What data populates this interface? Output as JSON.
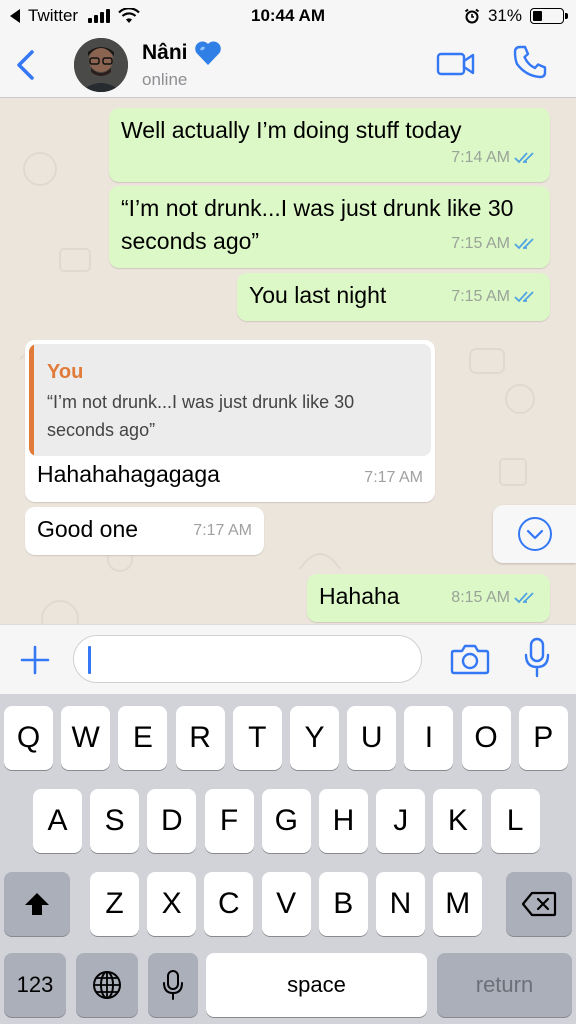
{
  "status_bar": {
    "back_app": "Twitter",
    "time": "10:44 AM",
    "battery": "31%",
    "battery_level": 0.31
  },
  "header": {
    "contact_name": "Nâni",
    "name_emoji": "💙",
    "status": "online"
  },
  "messages": [
    {
      "direction": "out",
      "text": "Well actually I’m doing stuff today",
      "time": "7:14 AM"
    },
    {
      "direction": "out",
      "text": "“I’m not drunk...I was just drunk like 30 seconds ago”",
      "time": "7:15 AM"
    },
    {
      "direction": "out",
      "text": "You last night",
      "time": "7:15 AM"
    },
    {
      "direction": "in",
      "reply_author": "You",
      "reply_text": "“I’m not drunk...I was just drunk like 30 seconds ago”",
      "text": "Hahahahagagaga",
      "time": "7:17 AM"
    },
    {
      "direction": "in",
      "text": "Good one",
      "time": "7:17 AM"
    },
    {
      "direction": "out",
      "text": "Hahaha",
      "time": "8:15 AM"
    }
  ],
  "input": {
    "value": "",
    "placeholder": ""
  },
  "keyboard": {
    "row1": [
      "Q",
      "W",
      "E",
      "R",
      "T",
      "Y",
      "U",
      "I",
      "O",
      "P"
    ],
    "row2": [
      "A",
      "S",
      "D",
      "F",
      "G",
      "H",
      "J",
      "K",
      "L"
    ],
    "row3": [
      "Z",
      "X",
      "C",
      "V",
      "B",
      "N",
      "M"
    ],
    "numbers_label": "123",
    "space_label": "space",
    "return_label": "return"
  },
  "colors": {
    "accent": "#3478f6",
    "outgoing_bubble": "#dcf8c6",
    "incoming_bubble": "#ffffff",
    "reply_accent": "#e07b39",
    "read_ticks": "#4fa3e3"
  },
  "icons": [
    "back-chevron-icon",
    "video-call-icon",
    "phone-icon",
    "plus-icon",
    "camera-icon",
    "microphone-icon",
    "scroll-down-icon",
    "read-ticks-icon",
    "shift-icon",
    "backspace-icon",
    "globe-icon",
    "keyboard-mic-icon",
    "wifi-icon",
    "alarm-icon",
    "blue-heart-icon"
  ]
}
